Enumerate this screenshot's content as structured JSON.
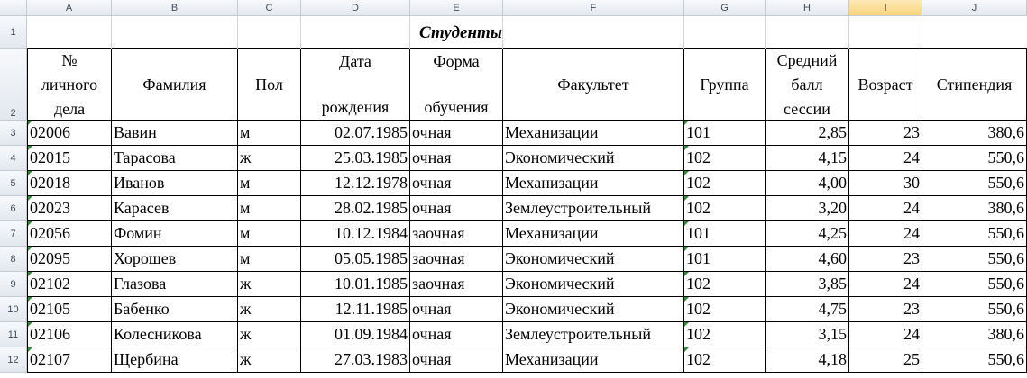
{
  "columns": [
    "A",
    "B",
    "C",
    "D",
    "E",
    "F",
    "G",
    "H",
    "I",
    "J"
  ],
  "selected_column": "I",
  "rows": [
    "1",
    "2",
    "3",
    "4",
    "5",
    "6",
    "7",
    "8",
    "9",
    "10",
    "11",
    "12"
  ],
  "title": "Студенты",
  "headers": {
    "a": [
      "№",
      "личного",
      "дела"
    ],
    "b": "Фамилия",
    "c": "Пол",
    "d": [
      "Дата",
      "рождения"
    ],
    "e": [
      "Форма",
      "обучения"
    ],
    "f": "Факультет",
    "g": "Группа",
    "h": [
      "Средний",
      "балл",
      "сессии"
    ],
    "i": "Возраст",
    "j": "Стипендия"
  },
  "students": [
    {
      "id": "02006",
      "surname": "Вавин",
      "sex": "м",
      "dob": "02.07.1985",
      "form": "очная",
      "faculty": "Механизации",
      "group": "101",
      "gpa": "2,85",
      "age": "23",
      "stipend": "380,6"
    },
    {
      "id": "02015",
      "surname": "Тарасова",
      "sex": "ж",
      "dob": "25.03.1985",
      "form": "очная",
      "faculty": "Экономический",
      "group": "102",
      "gpa": "4,15",
      "age": "24",
      "stipend": "550,6"
    },
    {
      "id": "02018",
      "surname": "Иванов",
      "sex": "м",
      "dob": "12.12.1978",
      "form": "очная",
      "faculty": "Механизации",
      "group": "102",
      "gpa": "4,00",
      "age": "30",
      "stipend": "550,6"
    },
    {
      "id": "02023",
      "surname": "Карасев",
      "sex": "м",
      "dob": "28.02.1985",
      "form": "очная",
      "faculty": "Землеустроительный",
      "group": "102",
      "gpa": "3,20",
      "age": "24",
      "stipend": "380,6"
    },
    {
      "id": "02056",
      "surname": "Фомин",
      "sex": "м",
      "dob": "10.12.1984",
      "form": "заочная",
      "faculty": "Механизации",
      "group": "101",
      "gpa": "4,25",
      "age": "24",
      "stipend": "550,6"
    },
    {
      "id": "02095",
      "surname": "Хорошев",
      "sex": "м",
      "dob": "05.05.1985",
      "form": "заочная",
      "faculty": "Экономический",
      "group": "101",
      "gpa": "4,60",
      "age": "23",
      "stipend": "550,6"
    },
    {
      "id": "02102",
      "surname": "Глазова",
      "sex": "ж",
      "dob": "10.01.1985",
      "form": "заочная",
      "faculty": "Экономический",
      "group": "102",
      "gpa": "3,85",
      "age": "24",
      "stipend": "550,6"
    },
    {
      "id": "02105",
      "surname": "Бабенко",
      "sex": "ж",
      "dob": "12.11.1985",
      "form": "очная",
      "faculty": "Экономический",
      "group": "102",
      "gpa": "4,75",
      "age": "23",
      "stipend": "550,6"
    },
    {
      "id": "02106",
      "surname": "Колесникова",
      "sex": "ж",
      "dob": "01.09.1984",
      "form": "очная",
      "faculty": "Землеустроительный",
      "group": "102",
      "gpa": "3,15",
      "age": "24",
      "stipend": "380,6"
    },
    {
      "id": "02107",
      "surname": "Щербина",
      "sex": "ж",
      "dob": "27.03.1983",
      "form": "очная",
      "faculty": "Механизации",
      "group": "102",
      "gpa": "4,18",
      "age": "25",
      "stipend": "550,6"
    }
  ]
}
